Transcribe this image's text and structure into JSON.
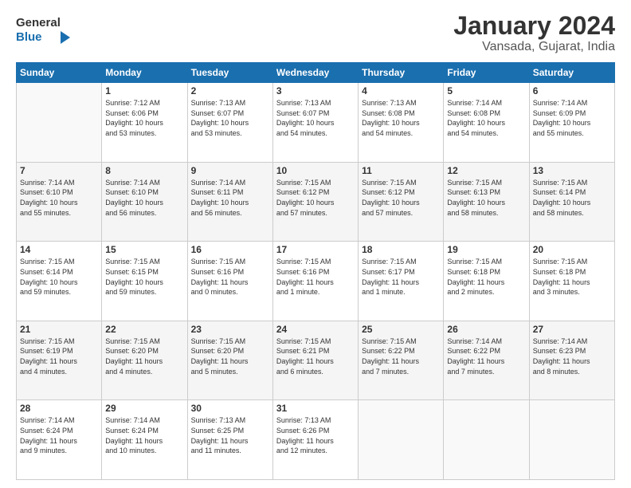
{
  "header": {
    "logo_line1": "General",
    "logo_line2": "Blue",
    "title": "January 2024",
    "subtitle": "Vansada, Gujarat, India"
  },
  "columns": [
    "Sunday",
    "Monday",
    "Tuesday",
    "Wednesday",
    "Thursday",
    "Friday",
    "Saturday"
  ],
  "weeks": [
    {
      "shade": false,
      "days": [
        {
          "num": "",
          "info": ""
        },
        {
          "num": "1",
          "info": "Sunrise: 7:12 AM\nSunset: 6:06 PM\nDaylight: 10 hours\nand 53 minutes."
        },
        {
          "num": "2",
          "info": "Sunrise: 7:13 AM\nSunset: 6:07 PM\nDaylight: 10 hours\nand 53 minutes."
        },
        {
          "num": "3",
          "info": "Sunrise: 7:13 AM\nSunset: 6:07 PM\nDaylight: 10 hours\nand 54 minutes."
        },
        {
          "num": "4",
          "info": "Sunrise: 7:13 AM\nSunset: 6:08 PM\nDaylight: 10 hours\nand 54 minutes."
        },
        {
          "num": "5",
          "info": "Sunrise: 7:14 AM\nSunset: 6:08 PM\nDaylight: 10 hours\nand 54 minutes."
        },
        {
          "num": "6",
          "info": "Sunrise: 7:14 AM\nSunset: 6:09 PM\nDaylight: 10 hours\nand 55 minutes."
        }
      ]
    },
    {
      "shade": true,
      "days": [
        {
          "num": "7",
          "info": "Sunrise: 7:14 AM\nSunset: 6:10 PM\nDaylight: 10 hours\nand 55 minutes."
        },
        {
          "num": "8",
          "info": "Sunrise: 7:14 AM\nSunset: 6:10 PM\nDaylight: 10 hours\nand 56 minutes."
        },
        {
          "num": "9",
          "info": "Sunrise: 7:14 AM\nSunset: 6:11 PM\nDaylight: 10 hours\nand 56 minutes."
        },
        {
          "num": "10",
          "info": "Sunrise: 7:15 AM\nSunset: 6:12 PM\nDaylight: 10 hours\nand 57 minutes."
        },
        {
          "num": "11",
          "info": "Sunrise: 7:15 AM\nSunset: 6:12 PM\nDaylight: 10 hours\nand 57 minutes."
        },
        {
          "num": "12",
          "info": "Sunrise: 7:15 AM\nSunset: 6:13 PM\nDaylight: 10 hours\nand 58 minutes."
        },
        {
          "num": "13",
          "info": "Sunrise: 7:15 AM\nSunset: 6:14 PM\nDaylight: 10 hours\nand 58 minutes."
        }
      ]
    },
    {
      "shade": false,
      "days": [
        {
          "num": "14",
          "info": "Sunrise: 7:15 AM\nSunset: 6:14 PM\nDaylight: 10 hours\nand 59 minutes."
        },
        {
          "num": "15",
          "info": "Sunrise: 7:15 AM\nSunset: 6:15 PM\nDaylight: 10 hours\nand 59 minutes."
        },
        {
          "num": "16",
          "info": "Sunrise: 7:15 AM\nSunset: 6:16 PM\nDaylight: 11 hours\nand 0 minutes."
        },
        {
          "num": "17",
          "info": "Sunrise: 7:15 AM\nSunset: 6:16 PM\nDaylight: 11 hours\nand 1 minute."
        },
        {
          "num": "18",
          "info": "Sunrise: 7:15 AM\nSunset: 6:17 PM\nDaylight: 11 hours\nand 1 minute."
        },
        {
          "num": "19",
          "info": "Sunrise: 7:15 AM\nSunset: 6:18 PM\nDaylight: 11 hours\nand 2 minutes."
        },
        {
          "num": "20",
          "info": "Sunrise: 7:15 AM\nSunset: 6:18 PM\nDaylight: 11 hours\nand 3 minutes."
        }
      ]
    },
    {
      "shade": true,
      "days": [
        {
          "num": "21",
          "info": "Sunrise: 7:15 AM\nSunset: 6:19 PM\nDaylight: 11 hours\nand 4 minutes."
        },
        {
          "num": "22",
          "info": "Sunrise: 7:15 AM\nSunset: 6:20 PM\nDaylight: 11 hours\nand 4 minutes."
        },
        {
          "num": "23",
          "info": "Sunrise: 7:15 AM\nSunset: 6:20 PM\nDaylight: 11 hours\nand 5 minutes."
        },
        {
          "num": "24",
          "info": "Sunrise: 7:15 AM\nSunset: 6:21 PM\nDaylight: 11 hours\nand 6 minutes."
        },
        {
          "num": "25",
          "info": "Sunrise: 7:15 AM\nSunset: 6:22 PM\nDaylight: 11 hours\nand 7 minutes."
        },
        {
          "num": "26",
          "info": "Sunrise: 7:14 AM\nSunset: 6:22 PM\nDaylight: 11 hours\nand 7 minutes."
        },
        {
          "num": "27",
          "info": "Sunrise: 7:14 AM\nSunset: 6:23 PM\nDaylight: 11 hours\nand 8 minutes."
        }
      ]
    },
    {
      "shade": false,
      "days": [
        {
          "num": "28",
          "info": "Sunrise: 7:14 AM\nSunset: 6:24 PM\nDaylight: 11 hours\nand 9 minutes."
        },
        {
          "num": "29",
          "info": "Sunrise: 7:14 AM\nSunset: 6:24 PM\nDaylight: 11 hours\nand 10 minutes."
        },
        {
          "num": "30",
          "info": "Sunrise: 7:13 AM\nSunset: 6:25 PM\nDaylight: 11 hours\nand 11 minutes."
        },
        {
          "num": "31",
          "info": "Sunrise: 7:13 AM\nSunset: 6:26 PM\nDaylight: 11 hours\nand 12 minutes."
        },
        {
          "num": "",
          "info": ""
        },
        {
          "num": "",
          "info": ""
        },
        {
          "num": "",
          "info": ""
        }
      ]
    }
  ]
}
